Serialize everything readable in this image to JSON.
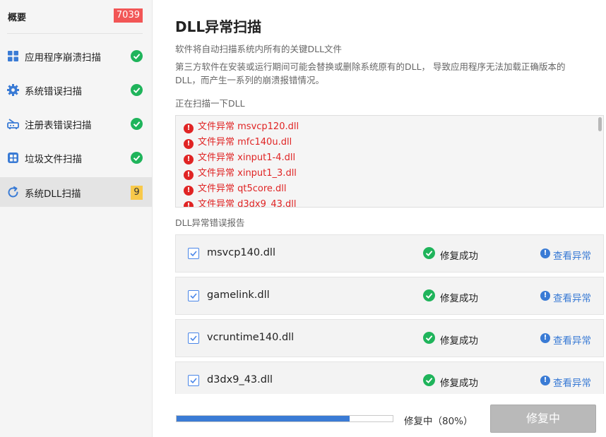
{
  "sidebar": {
    "title": "概要",
    "count": "7039",
    "items": [
      {
        "label": "应用程序崩溃扫描",
        "icon": "grid-icon",
        "status": "done"
      },
      {
        "label": "系统错误扫描",
        "icon": "gear-icon",
        "status": "done"
      },
      {
        "label": "注册表错误扫描",
        "icon": "router-icon",
        "status": "done"
      },
      {
        "label": "垃圾文件扫描",
        "icon": "trash-box-icon",
        "status": "done"
      },
      {
        "label": "系统DLL扫描",
        "icon": "refresh-icon",
        "status": "count",
        "badge": "9"
      }
    ]
  },
  "main": {
    "title": "DLL异常扫描",
    "desc_line1": "软件将自动扫描系统内所有的关键DLL文件",
    "desc_line2": "第三方软件在安装或运行期间可能会替换或删除系统原有的DLL， 导致应用程序无法加载正确版本的",
    "desc_line3": "DLL，而产生一系列的崩溃报错情况。",
    "scanning_label": "正在扫描一下DLL",
    "scan_lines": [
      "文件异常 msvcp120.dll",
      "文件异常 mfc140u.dll",
      "文件异常 xinput1-4.dll",
      "文件异常 xinput1_3.dll",
      "文件异常 qt5core.dll",
      "文件异常 d3dx9_43.dll"
    ],
    "report_label": "DLL异常错误报告",
    "report_rows": [
      {
        "file": "msvcp140.dll",
        "status": "修复成功",
        "link": "查看异常"
      },
      {
        "file": "gamelink.dll",
        "status": "修复成功",
        "link": "查看异常"
      },
      {
        "file": "vcruntime140.dll",
        "status": "修复成功",
        "link": "查看异常"
      },
      {
        "file": "d3dx9_43.dll",
        "status": "修复成功",
        "link": "查看异常"
      }
    ],
    "progress_text": "修复中（80%）",
    "progress_value": 0.8,
    "button_label": "修复中"
  },
  "colors": {
    "accent": "#3a7bd5",
    "success": "#1fb45b",
    "error": "#e02424",
    "count_badge": "#f25656",
    "warn_badge": "#f8c94a"
  }
}
